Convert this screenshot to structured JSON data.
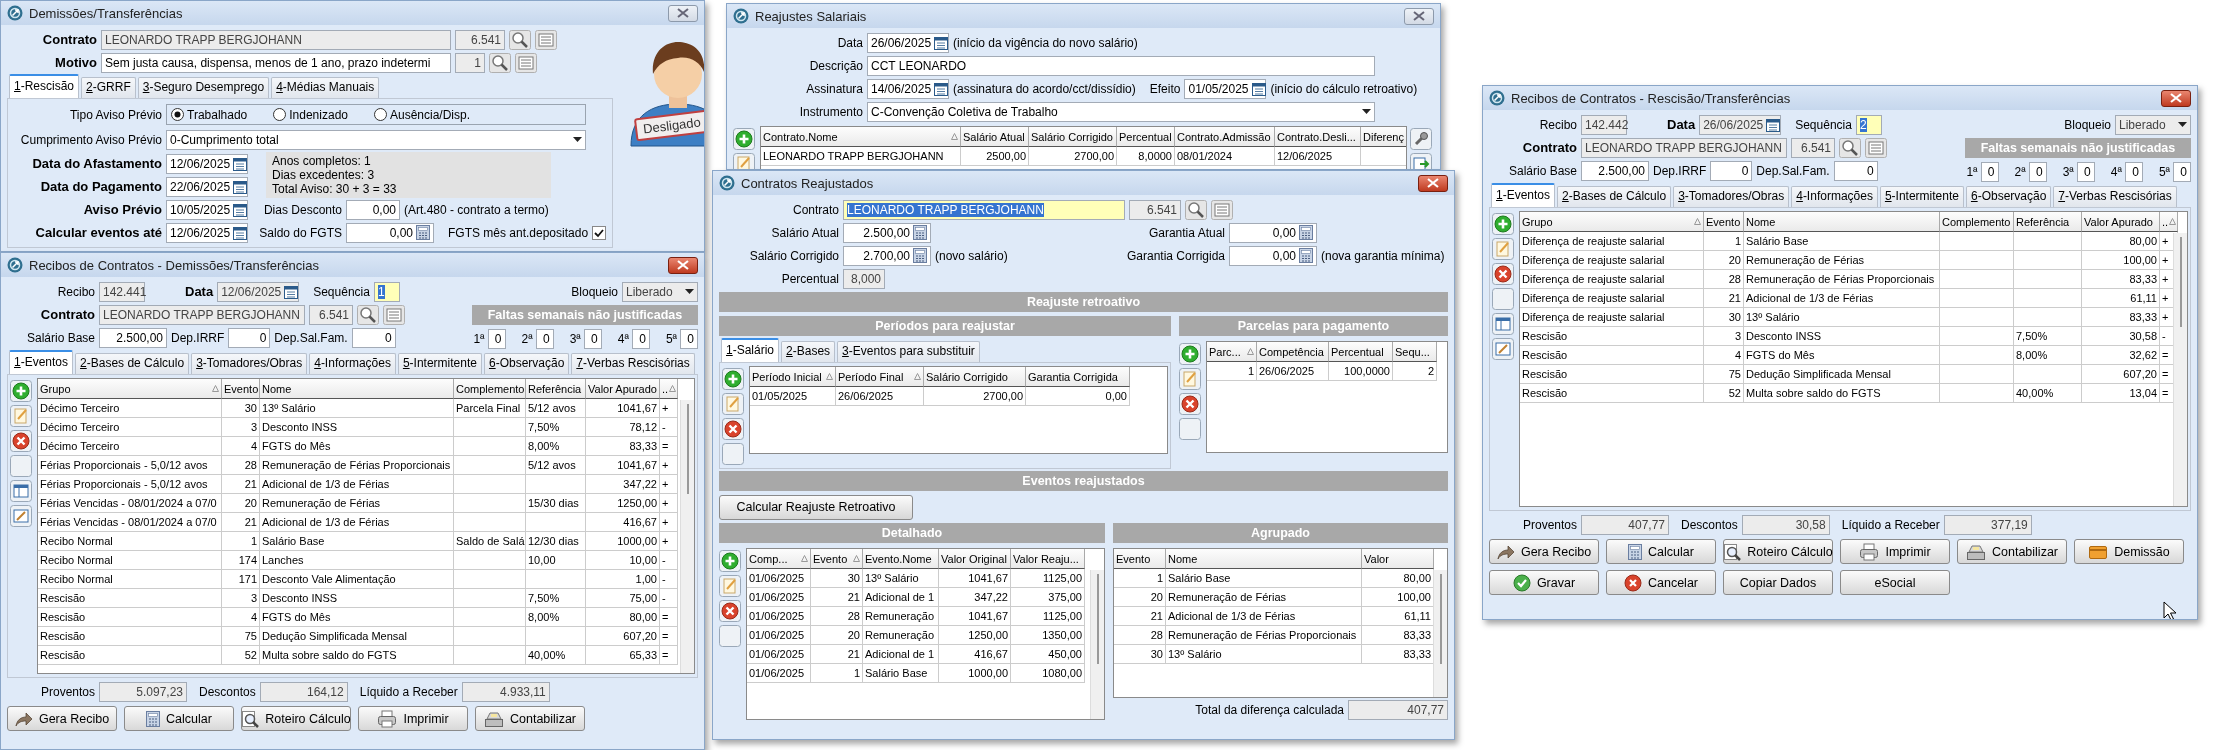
{
  "demissoes": {
    "title": "Demissões/Transferências",
    "active": false,
    "contrato": {
      "label": "Contrato",
      "value": "LEONARDO TRAPP BERGJOHANN",
      "code": "6.541"
    },
    "motivo": {
      "label": "Motivo",
      "value": "Sem justa causa, dispensa, menos de 1 ano, prazo indetermi",
      "code": "1"
    },
    "status_badge": "Desligado",
    "tabs": [
      {
        "label": "1-Rescisão",
        "selected": true
      },
      {
        "label": "2-GRRF",
        "selected": false
      },
      {
        "label": "3-Seguro Desemprego",
        "selected": false
      },
      {
        "label": "4-Médias Manuais",
        "selected": false
      }
    ],
    "tipo_aviso": {
      "label": "Tipo Aviso Prévio",
      "options": [
        {
          "label": "Trabalhado",
          "selected": true
        },
        {
          "label": "Indenizado",
          "selected": false
        },
        {
          "label": "Ausência/Disp.",
          "selected": false
        }
      ]
    },
    "cumprimento": {
      "label": "Cumprimento Aviso Prévio",
      "value": "0-Cumprimento total"
    },
    "dates": [
      {
        "label": "Data do Afastamento",
        "value": "12/06/2025"
      },
      {
        "label": "Data do Pagamento",
        "value": "22/06/2025"
      },
      {
        "label": "Aviso Prévio",
        "value": "10/05/2025"
      },
      {
        "label": "Calcular eventos até",
        "value": "12/06/2025"
      }
    ],
    "summary_lines": [
      "Anos completos: 1",
      "Dias excedentes: 3",
      "Total Aviso: 30 + 3 = 33"
    ],
    "dias_desconto": {
      "label": "Dias Desconto",
      "value": "0,00",
      "note": "(Art.480 - contrato a termo)"
    },
    "saldo_fgts": {
      "label": "Saldo do FGTS",
      "value": "0,00"
    },
    "fgts_depositado": {
      "label": "FGTS mês ant.depositado",
      "checked": true
    }
  },
  "recibo_demissao": {
    "title": "Recibos de Contratos - Demissões/Transferências",
    "active": true,
    "recibo": {
      "label": "Recibo",
      "value": "142.441"
    },
    "data": {
      "label": "Data",
      "value": "12/06/2025"
    },
    "sequencia": {
      "label": "Sequência",
      "value": "1",
      "focused": true
    },
    "bloqueio": {
      "label": "Bloqueio",
      "value": "Liberado"
    },
    "contrato": {
      "label": "Contrato",
      "value": "LEONARDO TRAPP BERGJOHANN",
      "code": "6.541"
    },
    "salario_base": {
      "label": "Salário Base",
      "value": "2.500,00"
    },
    "dep_irrf": {
      "label": "Dep.IRRF",
      "value": "0"
    },
    "dep_sal_fam": {
      "label": "Dep.Sal.Fam.",
      "value": "0"
    },
    "faltas": {
      "title": "Faltas semanais não justificadas",
      "weeks": [
        {
          "label": "1ª",
          "value": "0"
        },
        {
          "label": "2ª",
          "value": "0"
        },
        {
          "label": "3ª",
          "value": "0"
        },
        {
          "label": "4ª",
          "value": "0"
        },
        {
          "label": "5ª",
          "value": "0"
        }
      ]
    },
    "tabs": [
      {
        "label": "1-Eventos",
        "selected": true
      },
      {
        "label": "2-Bases de Cálculo",
        "selected": false
      },
      {
        "label": "3-Tomadores/Obras",
        "selected": false
      },
      {
        "label": "4-Informações",
        "selected": false
      },
      {
        "label": "5-Intermitente",
        "selected": false
      },
      {
        "label": "6-Observação",
        "selected": false
      },
      {
        "label": "7-Verbas Rescisórias",
        "selected": false
      }
    ],
    "grid": {
      "side_buttons": [
        {
          "kind": "add"
        },
        {
          "kind": "edit"
        },
        {
          "kind": "delete"
        },
        {
          "kind": "blank"
        },
        {
          "kind": "layout"
        },
        {
          "kind": "layout-edit"
        }
      ],
      "columns": [
        {
          "label": "Grupo",
          "sorted": true
        },
        {
          "label": "Evento",
          "sorted": false
        },
        {
          "label": "Nome",
          "sorted": false
        },
        {
          "label": "Complemento",
          "sorted": false
        },
        {
          "label": "Referência",
          "sorted": false
        },
        {
          "label": "Valor Apurado",
          "sorted": false
        },
        {
          "label": "..",
          "sorted": true
        }
      ],
      "rows": [
        [
          "Décimo Terceiro",
          "30",
          "13º Salário",
          "Parcela Final",
          "5/12 avos",
          "1041,67",
          "+"
        ],
        [
          "Décimo Terceiro",
          "3",
          "Desconto INSS",
          null,
          "7,50%",
          "78,12",
          "-"
        ],
        [
          "Décimo Terceiro",
          "4",
          "FGTS do Mês",
          null,
          "8,00%",
          "83,33",
          "="
        ],
        [
          "Férias Proporcionais - 5,0/12 avos",
          "28",
          "Remuneração de Férias Proporcionais",
          null,
          "5/12 avos",
          "1041,67",
          "+"
        ],
        [
          "Férias Proporcionais - 5,0/12 avos",
          "21",
          "Adicional de 1/3 de Férias",
          null,
          null,
          "347,22",
          "+"
        ],
        [
          "Férias Vencidas - 08/01/2024 a 07/0",
          "20",
          "Remuneração de Férias",
          null,
          "15/30 dias",
          "1250,00",
          "+"
        ],
        [
          "Férias Vencidas - 08/01/2024 a 07/0",
          "21",
          "Adicional de 1/3 de Férias",
          null,
          null,
          "416,67",
          "+"
        ],
        [
          "Recibo Normal",
          "1",
          "Salário Base",
          "Saldo de Salá",
          "12/30 dias",
          "1000,00",
          "+"
        ],
        [
          "Recibo Normal",
          "174",
          "Lanches",
          null,
          "10,00",
          "10,00",
          "-"
        ],
        [
          "Recibo Normal",
          "171",
          "Desconto Vale Alimentação",
          null,
          null,
          "1,00",
          "-"
        ],
        [
          "Rescisão",
          "3",
          "Desconto INSS",
          null,
          "7,50%",
          "75,00",
          "-"
        ],
        [
          "Rescisão",
          "4",
          "FGTS do Mês",
          null,
          "8,00%",
          "80,00",
          "="
        ],
        [
          "Rescisão",
          "75",
          "Dedução Simplificada Mensal",
          null,
          null,
          "607,20",
          "="
        ],
        [
          "Rescisão",
          "52",
          "Multa sobre saldo do FGTS",
          null,
          "40,00%",
          "65,33",
          "="
        ]
      ]
    },
    "totals": [
      {
        "label": "Proventos",
        "value": "5.097,23"
      },
      {
        "label": "Descontos",
        "value": "164,12"
      },
      {
        "label": "Líquido a Receber",
        "value": "4.933,11"
      }
    ],
    "button_rows": [
      {
        "buttons": [
          {
            "label": "Gera Recibo",
            "kind": "share"
          },
          {
            "label": "Calcular",
            "kind": "calc"
          },
          {
            "label": "Roteiro Cálculo",
            "kind": "search"
          },
          {
            "label": "Imprimir",
            "kind": "print"
          },
          {
            "label": "Contabilizar",
            "kind": "register"
          }
        ]
      }
    ]
  },
  "reajustes": {
    "title": "Reajustes Salariais",
    "active": false,
    "data": {
      "label": "Data",
      "value": "26/06/2025",
      "note": "(início da vigência do novo salário)"
    },
    "descricao": {
      "label": "Descrição",
      "value": "CCT LEONARDO"
    },
    "assinatura": {
      "label": "Assinatura",
      "value": "14/06/2025",
      "note": "(assinatura do acordo/cct/dissídio)"
    },
    "efeito": {
      "label": "Efeito",
      "value": "01/05/2025",
      "note": "(início do cálculo retroativo)"
    },
    "instrumento": {
      "label": "Instrumento",
      "value": "C-Convenção Coletiva de Trabalho"
    },
    "grid": {
      "side_buttons": [
        {
          "kind": "add"
        },
        {
          "kind": "edit"
        }
      ],
      "tool_buttons": [
        {
          "kind": "tools"
        },
        {
          "kind": "export"
        }
      ],
      "columns": [
        {
          "label": "Contrato.Nome",
          "sorted": true
        },
        {
          "label": "Salário Atual",
          "sorted": false
        },
        {
          "label": "Salário Corrigido",
          "sorted": false
        },
        {
          "label": "Percentual",
          "sorted": false
        },
        {
          "label": "Contrato.Admissão",
          "sorted": false
        },
        {
          "label": "Contrato.Desli...",
          "sorted": false
        },
        {
          "label": "Diferenç",
          "sorted": false
        }
      ],
      "rows": [
        [
          "LEONARDO TRAPP BERGJOHANN",
          "2500,00",
          "2700,00",
          "8,0000",
          "08/01/2024",
          "12/06/2025",
          null
        ]
      ]
    }
  },
  "contratos_reajustados": {
    "title": "Contratos Reajustados",
    "active": true,
    "contrato": {
      "label": "Contrato",
      "value": "LEONARDO TRAPP BERGJOHANN",
      "code": "6.541",
      "focused": true
    },
    "salario_atual": {
      "label": "Salário Atual",
      "value": "2.500,00"
    },
    "garantia_atual": {
      "label": "Garantia Atual",
      "value": "0,00"
    },
    "salario_corrigido": {
      "label": "Salário Corrigido",
      "value": "2.700,00",
      "note": "(novo salário)"
    },
    "garantia_corrigida": {
      "label": "Garantia Corrigida",
      "value": "0,00",
      "note": "(nova garantia mínima)"
    },
    "percentual": {
      "label": "Percentual",
      "value": "8,000"
    },
    "retro_title": "Reajuste retroativo",
    "periodos": {
      "title": "Períodos para reajustar",
      "tabs": [
        {
          "label": "1-Salário",
          "selected": true
        },
        {
          "label": "2-Bases",
          "selected": false
        },
        {
          "label": "3-Eventos para substituir",
          "selected": false
        }
      ],
      "grid": {
        "side_buttons": [
          {
            "kind": "add"
          },
          {
            "kind": "edit"
          },
          {
            "kind": "delete"
          },
          {
            "kind": "blank"
          }
        ],
        "columns": [
          {
            "label": "Período Inicial",
            "sorted": true
          },
          {
            "label": "Período Final",
            "sorted": true
          },
          {
            "label": "Salário Corrigido",
            "sorted": false
          },
          {
            "label": "Garantia Corrigida",
            "sorted": false
          }
        ],
        "rows": [
          [
            "01/05/2025",
            "26/06/2025",
            "2700,00",
            "0,00"
          ]
        ]
      }
    },
    "parcelas": {
      "title": "Parcelas para pagamento",
      "grid": {
        "side_buttons": [
          {
            "kind": "add"
          },
          {
            "kind": "edit"
          },
          {
            "kind": "delete"
          },
          {
            "kind": "blank"
          }
        ],
        "columns": [
          {
            "label": "Parc...",
            "sorted": true
          },
          {
            "label": "Competência",
            "sorted": false
          },
          {
            "label": "Percentual",
            "sorted": false
          },
          {
            "label": "Sequ...",
            "sorted": false
          }
        ],
        "rows": [
          [
            "1",
            "26/06/2025",
            "100,0000",
            "2"
          ]
        ]
      }
    },
    "eventos_title": "Eventos reajustados",
    "calc_button": "Calcular Reajuste Retroativo",
    "detalhado": {
      "title": "Detalhado",
      "grid": {
        "side_buttons": [
          {
            "kind": "add"
          },
          {
            "kind": "edit"
          },
          {
            "kind": "delete"
          },
          {
            "kind": "blank"
          }
        ],
        "columns": [
          {
            "label": "Comp...",
            "sorted": true
          },
          {
            "label": "Evento",
            "sorted": true
          },
          {
            "label": "Evento.Nome",
            "sorted": false
          },
          {
            "label": "Valor Original",
            "sorted": false
          },
          {
            "label": "Valor Reaju...",
            "sorted": false
          }
        ],
        "rows": [
          [
            "01/06/2025",
            "30",
            "13º Salário",
            "1041,67",
            "1125,00"
          ],
          [
            "01/06/2025",
            "21",
            "Adicional de 1",
            "347,22",
            "375,00"
          ],
          [
            "01/06/2025",
            "28",
            "Remuneração",
            "1041,67",
            "1125,00"
          ],
          [
            "01/06/2025",
            "20",
            "Remuneração",
            "1250,00",
            "1350,00"
          ],
          [
            "01/06/2025",
            "21",
            "Adicional de 1",
            "416,67",
            "450,00"
          ],
          [
            "01/06/2025",
            "1",
            "Salário Base",
            "1000,00",
            "1080,00"
          ]
        ]
      }
    },
    "agrupado": {
      "title": "Agrupado",
      "grid": {
        "columns": [
          {
            "label": "Evento",
            "sorted": false
          },
          {
            "label": "Nome",
            "sorted": false
          },
          {
            "label": "Valor",
            "sorted": false
          }
        ],
        "rows": [
          [
            "1",
            "Salário Base",
            "80,00"
          ],
          [
            "20",
            "Remuneração de Férias",
            "100,00"
          ],
          [
            "21",
            "Adicional de 1/3 de Férias",
            "61,11"
          ],
          [
            "28",
            "Remuneração de Férias Proporcionais",
            "83,33"
          ],
          [
            "30",
            "13º Salário",
            "83,33"
          ]
        ]
      }
    },
    "total": {
      "label": "Total da diferença calculada",
      "value": "407,77"
    }
  },
  "recibo_rescisao": {
    "title": "Recibos de Contratos - Rescisão/Transferências",
    "active": true,
    "recibo": {
      "label": "Recibo",
      "value": "142.442"
    },
    "data": {
      "label": "Data",
      "value": "26/06/2025"
    },
    "sequencia": {
      "label": "Sequência",
      "value": "2",
      "focused": true
    },
    "bloqueio": {
      "label": "Bloqueio",
      "value": "Liberado"
    },
    "contrato": {
      "label": "Contrato",
      "value": "LEONARDO TRAPP BERGJOHANN",
      "code": "6.541"
    },
    "salario_base": {
      "label": "Salário Base",
      "value": "2.500,00"
    },
    "dep_irrf": {
      "label": "Dep.IRRF",
      "value": "0"
    },
    "dep_sal_fam": {
      "label": "Dep.Sal.Fam.",
      "value": "0"
    },
    "faltas": {
      "title": "Faltas semanais não justificadas",
      "weeks": [
        {
          "label": "1ª",
          "value": "0"
        },
        {
          "label": "2ª",
          "value": "0"
        },
        {
          "label": "3ª",
          "value": "0"
        },
        {
          "label": "4ª",
          "value": "0"
        },
        {
          "label": "5ª",
          "value": "0"
        }
      ]
    },
    "tabs": [
      {
        "label": "1-Eventos",
        "selected": true
      },
      {
        "label": "2-Bases de Cálculo",
        "selected": false
      },
      {
        "label": "3-Tomadores/Obras",
        "selected": false
      },
      {
        "label": "4-Informações",
        "selected": false
      },
      {
        "label": "5-Intermitente",
        "selected": false
      },
      {
        "label": "6-Observação",
        "selected": false
      },
      {
        "label": "7-Verbas Rescisórias",
        "selected": false
      }
    ],
    "grid": {
      "side_buttons": [
        {
          "kind": "add"
        },
        {
          "kind": "edit"
        },
        {
          "kind": "delete"
        },
        {
          "kind": "blank"
        },
        {
          "kind": "layout"
        },
        {
          "kind": "layout-edit"
        }
      ],
      "columns": [
        {
          "label": "Grupo",
          "sorted": true
        },
        {
          "label": "Evento",
          "sorted": false
        },
        {
          "label": "Nome",
          "sorted": false
        },
        {
          "label": "Complemento",
          "sorted": false
        },
        {
          "label": "Referência",
          "sorted": false
        },
        {
          "label": "Valor Apurado",
          "sorted": false
        },
        {
          "label": "..",
          "sorted": true
        }
      ],
      "rows": [
        [
          "Diferença de reajuste salarial",
          "1",
          "Salário Base",
          null,
          null,
          "80,00",
          "+"
        ],
        [
          "Diferença de reajuste salarial",
          "20",
          "Remuneração de Férias",
          null,
          null,
          "100,00",
          "+"
        ],
        [
          "Diferença de reajuste salarial",
          "28",
          "Remuneração de Férias Proporcionais",
          null,
          null,
          "83,33",
          "+"
        ],
        [
          "Diferença de reajuste salarial",
          "21",
          "Adicional de 1/3 de Férias",
          null,
          null,
          "61,11",
          "+"
        ],
        [
          "Diferença de reajuste salarial",
          "30",
          "13º Salário",
          null,
          null,
          "83,33",
          "+"
        ],
        [
          "Rescisão",
          "3",
          "Desconto INSS",
          null,
          "7,50%",
          "30,58",
          "-"
        ],
        [
          "Rescisão",
          "4",
          "FGTS do Mês",
          null,
          "8,00%",
          "32,62",
          "="
        ],
        [
          "Rescisão",
          "75",
          "Dedução Simplificada Mensal",
          null,
          null,
          "607,20",
          "="
        ],
        [
          "Rescisão",
          "52",
          "Multa sobre saldo do FGTS",
          null,
          "40,00%",
          "13,04",
          "="
        ]
      ]
    },
    "totals": [
      {
        "label": "Proventos",
        "value": "407,77"
      },
      {
        "label": "Descontos",
        "value": "30,58"
      },
      {
        "label": "Líquido a Receber",
        "value": "377,19"
      }
    ],
    "button_rows": [
      {
        "buttons": [
          {
            "label": "Gera Recibo",
            "kind": "share"
          },
          {
            "label": "Calcular",
            "kind": "calc"
          },
          {
            "label": "Roteiro Cálculo",
            "kind": "search"
          },
          {
            "label": "Imprimir",
            "kind": "print"
          },
          {
            "label": "Contabilizar",
            "kind": "register"
          },
          {
            "label": "Demissão",
            "kind": "card"
          }
        ]
      },
      {
        "buttons": [
          {
            "label": "Gravar",
            "kind": "check"
          },
          {
            "label": "Cancelar",
            "kind": "cancel"
          },
          {
            "label": "Copiar Dados",
            "kind": "plain"
          },
          {
            "label": "eSocial",
            "kind": "plain"
          }
        ]
      }
    ]
  }
}
